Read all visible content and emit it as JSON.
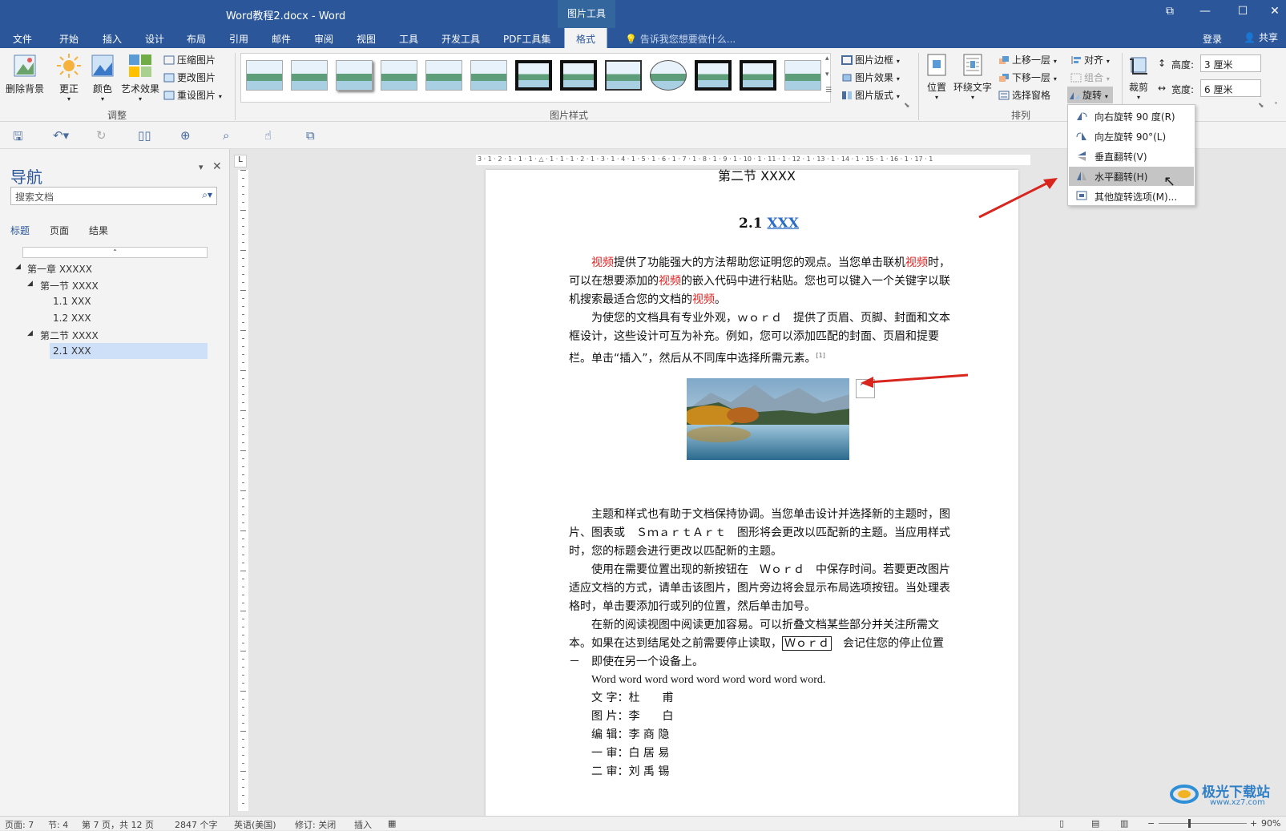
{
  "window": {
    "title": "Word教程2.docx - Word",
    "context_tab_title": "图片工具"
  },
  "tabs": [
    "文件",
    "开始",
    "插入",
    "设计",
    "布局",
    "引用",
    "邮件",
    "审阅",
    "视图",
    "工具",
    "开发工具",
    "PDF工具集",
    "格式"
  ],
  "tell_me": "告诉我您想要做什么...",
  "account": {
    "login": "登录",
    "share": "共享"
  },
  "ribbon": {
    "remove_bg": "删除背景",
    "correct": "更正",
    "color": "颜色",
    "artistic": "艺术效果",
    "compress": "压缩图片",
    "change": "更改图片",
    "reset": "重设图片",
    "group_adjust": "调整",
    "group_styles": "图片样式",
    "border": "图片边框",
    "effects": "图片效果",
    "layout": "图片版式",
    "position": "位置",
    "wrap": "环绕文字",
    "bring_forward": "上移一层",
    "send_backward": "下移一层",
    "selection_pane": "选择窗格",
    "align": "对齐",
    "group": "组合",
    "rotate": "旋转",
    "group_arrange": "排列",
    "crop": "裁剪",
    "height_label": "高度:",
    "height_value": "3 厘米",
    "width_label": "宽度:",
    "width_value": "6 厘米"
  },
  "rotate_menu": [
    {
      "label": "向右旋转 90 度(R)",
      "icon": "rotate-right-icon"
    },
    {
      "label": "向左旋转 90°(L)",
      "icon": "rotate-left-icon"
    },
    {
      "label": "垂直翻转(V)",
      "icon": "flip-vertical-icon"
    },
    {
      "label": "水平翻转(H)",
      "icon": "flip-horizontal-icon"
    },
    {
      "label": "其他旋转选项(M)...",
      "icon": "more-rotation-icon"
    }
  ],
  "nav": {
    "title": "导航",
    "search_placeholder": "搜索文档",
    "tabs": [
      "标题",
      "页面",
      "结果"
    ],
    "items": [
      "第一章 XXXXX",
      "第一节 XXXX",
      "1.1 XXX",
      "1.2 XXX",
      "第二节 XXXX",
      "2.1 XXX"
    ]
  },
  "doc": {
    "section_header": "第二节 XXXX",
    "heading_num": "2.1",
    "heading_link": "XXX",
    "p1a_red": "视频",
    "p1b": "提供了功能强大的方法帮助您证明您的观点。当您单击联机",
    "p1c_red": "视频",
    "p1d": "时，",
    "p1e": "可以在想要添加的",
    "p1f_red": "视频",
    "p1g": "的嵌入代码中进行粘贴。您也可以键入一个关键字以联",
    "p1h": "机搜索最适合您的文档的",
    "p1i_red": "视频",
    "p1j": "。",
    "p2a": "为使您的文档具有专业外观，ｗｏｒｄ　提供了页眉、页脚、封面和文本",
    "p2b": "框设计，这些设计可互为补充。例如，您可以添加匹配的封面、页眉和提要",
    "p2c": "栏。单击“插入”，然后从不同库中选择所需元素。",
    "p2_footnote": "[1]",
    "p3a": "主题和样式也有助于文档保持协调。当您单击设计并选择新的主题时，图",
    "p3b": "片、图表或　ＳｍａｒｔＡｒｔ　图形将会更改以匹配新的主题。当应用样式",
    "p3c": "时，您的标题会进行更改以匹配新的主题。",
    "p4a": "使用在需要位置出现的新按钮在　Ｗｏｒｄ　中保存时间。若要更改图片",
    "p4b": "适应文档的方式，请单击该图片，图片旁边将会显示布局选项按钮。当处理表",
    "p4c": "格时，单击要添加行或列的位置，然后单击加号。",
    "p5a": "在新的阅读视图中阅读更加容易。可以折叠文档某些部分并关注所需文",
    "p5b1": "本。如果在达到结尾处之前需要停止读取，",
    "p5b_box": "Ｗｏｒｄ",
    "p5b2": "　会记住您的停止位置",
    "p5c": "－　即使在另一个设备上。",
    "p6": "Word word word word word word word word word.",
    "credits": [
      [
        "文 字：",
        "杜　　甫"
      ],
      [
        "图 片：",
        "李　　白"
      ],
      [
        "编 辑：",
        "李 商 隐"
      ],
      [
        "一 审：",
        "白 居 易"
      ],
      [
        "二 审：",
        "刘 禹 锡"
      ]
    ]
  },
  "status": {
    "page": "页面: 7",
    "section": "节: 4",
    "page_of": "第 7 页，共 12 页",
    "words": "2847 个字",
    "lang": "英语(美国)",
    "track": "修订: 关闭",
    "insert": "插入",
    "zoom": "90%"
  },
  "ruler_h": "3 · 1 · 2 · 1 · 1 · 1 · △ · 1 · 1 · 1 · 2 · 1 · 3 · 1 · 4 · 1 · 5 · 1 · 6 · 1 · 7 · 1 · 8 · 1 · 9 · 1 · 10 · 1 · 11 · 1 · 12 · 1 · 13 · 1 · 14 · 1 · 15 · 1 · 16 · 1 · 17 · 1",
  "watermark": "极光下载站",
  "watermark_url": "www.xz7.com"
}
